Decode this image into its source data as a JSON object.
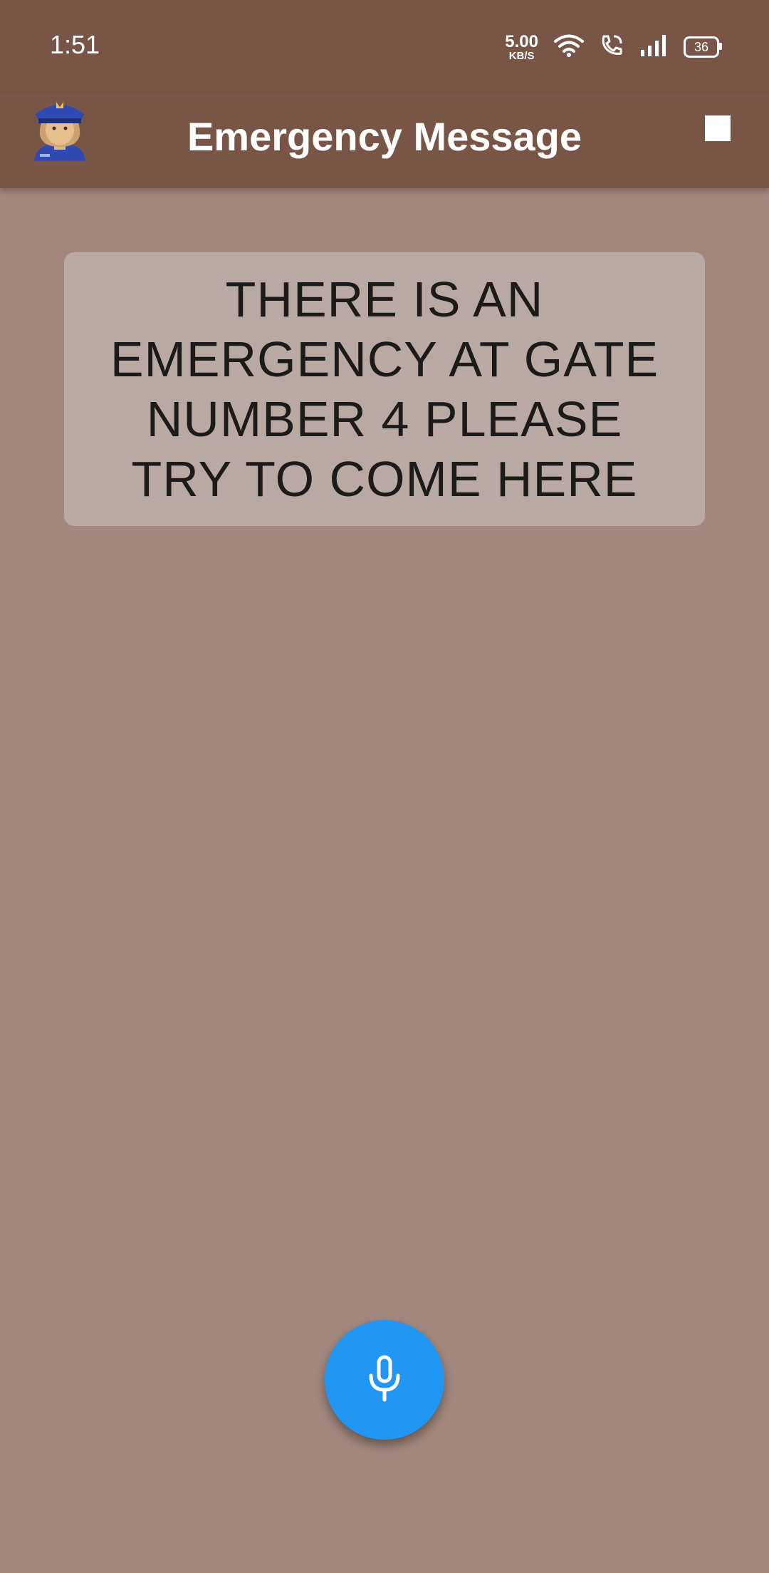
{
  "status_bar": {
    "time": "1:51",
    "net_speed_value": "5.00",
    "net_speed_unit": "KB/S",
    "battery": "36"
  },
  "app_bar": {
    "title": "Emergency Message",
    "avatar_icon": "police-officer-icon",
    "action_icon": "stop-icon"
  },
  "message": {
    "text": "THERE IS AN EMERGENCY AT GATE NUMBER 4 PLEASE TRY TO COME HERE"
  },
  "fab": {
    "icon": "microphone-icon",
    "color": "#2196f3"
  },
  "colors": {
    "app_bar": "#795548",
    "background": "#a1877d",
    "card": "#b8a9a4"
  }
}
